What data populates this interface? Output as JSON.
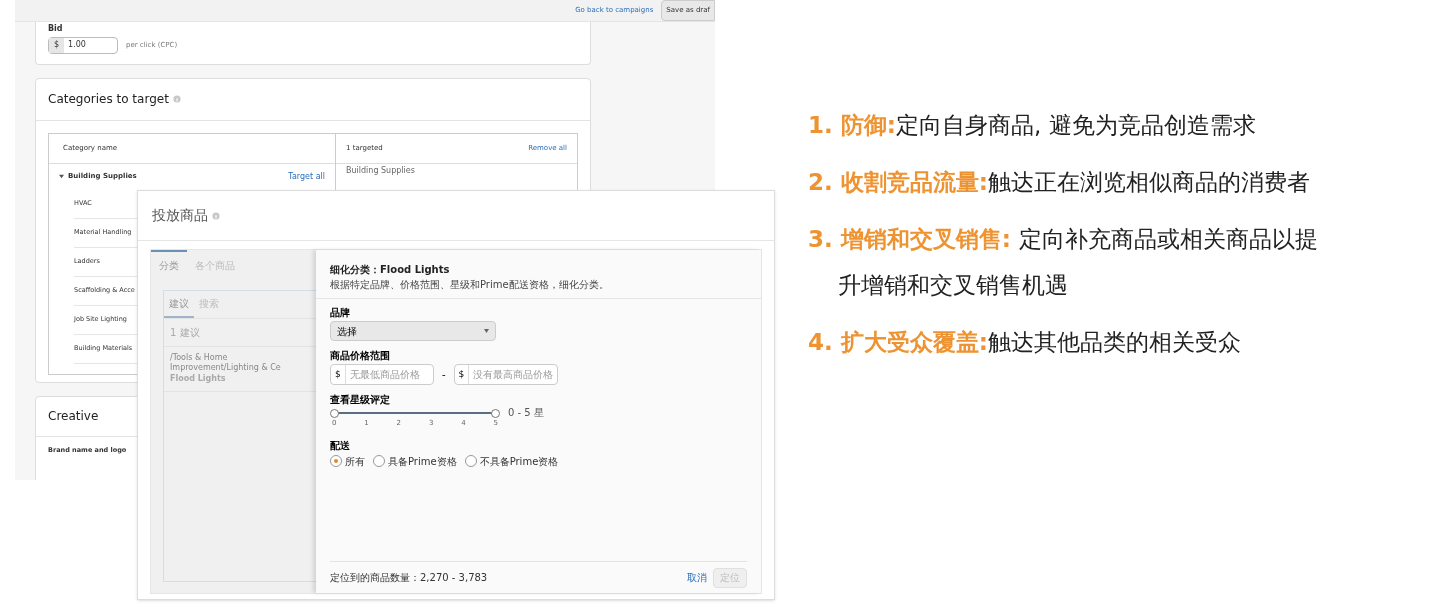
{
  "campaign_page": {
    "top_bar": {
      "link": "Go back to campaigns",
      "button": "Save as draf"
    },
    "bid": {
      "label": "Bid",
      "currency": "$",
      "value": "1.00",
      "unit": "per click (CPC)"
    },
    "categories": {
      "title": "Categories to target",
      "header": {
        "column_1": "Category name",
        "count": "1 targeted",
        "remove": "Remove all"
      },
      "group": {
        "name": "Building Supplies",
        "expanded": true,
        "action": "Target all",
        "children": [
          {
            "name": "HVAC"
          },
          {
            "name": "Material Handling"
          },
          {
            "name": "Ladders"
          },
          {
            "name": "Scaffolding & Acce"
          },
          {
            "name": "Job Site Lighting"
          },
          {
            "name": "Building Materials"
          }
        ]
      },
      "targeted": [
        "Building Supplies"
      ]
    },
    "creative": {
      "title": "Creative",
      "label": "Brand name and logo"
    }
  },
  "modal": {
    "title": "投放商品",
    "tabs": [
      {
        "label": "分类",
        "selected": true
      },
      {
        "label": "各个商品",
        "selected": false
      }
    ],
    "subtabs": [
      {
        "label": "建议",
        "selected": true
      },
      {
        "label": "搜索",
        "selected": false
      }
    ],
    "suggestion_count": "1 建议",
    "suggestion": {
      "path": "/Tools & Home Improvement/Lighting & Ce",
      "name": "Flood Lights"
    },
    "refine": {
      "title": "细化分类：Flood Lights",
      "hint": "根据特定品牌、价格范围、星级和Prime配送资格，细化分类。",
      "brand": {
        "label": "品牌",
        "value": "选择"
      },
      "price": {
        "label": "商品价格范围",
        "currency": "$",
        "min_placeholder": "无最低商品价格",
        "separator": "-",
        "max_placeholder": "没有最高商品价格"
      },
      "rating": {
        "label": "查看星级评定",
        "level": 1,
        "ticks": [
          "0",
          "1",
          "2",
          "3",
          "4",
          "5"
        ],
        "reading": "0 - 5 星"
      },
      "shipping": {
        "label": "配送",
        "options": [
          {
            "label": "所有",
            "selected": true
          },
          {
            "label": "具备Prime资格",
            "selected": false
          },
          {
            "label": "不具备Prime资格",
            "selected": false
          }
        ]
      }
    },
    "footer": {
      "count": "定位到的商品数量：2,270 - 3,783",
      "cancel": "取消",
      "submit": {
        "label": "定位",
        "disabled": true
      }
    }
  },
  "points": [
    {
      "heading": "1. 防御:",
      "lines": [
        "定向自身商品, 避免为竞品创造需求"
      ]
    },
    {
      "heading": "2. 收割竞品流量:",
      "lines": [
        "触达正在浏览相似商品的消费者"
      ]
    },
    {
      "heading": "3. 增销和交叉销售: ",
      "lines": [
        "定向补充商品或相关商品以提",
        "升增销和交叉销售机遇"
      ]
    },
    {
      "heading": "4. 扩大受众覆盖:",
      "lines": [
        "触达其他品类的相关受众"
      ]
    }
  ]
}
